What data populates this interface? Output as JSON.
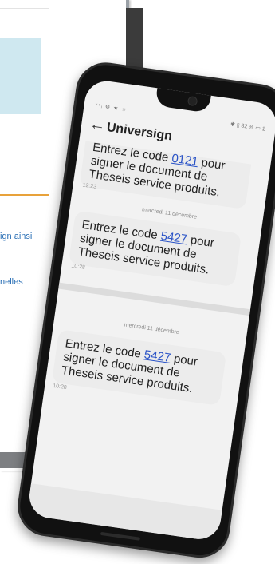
{
  "background_doc": {
    "link1": "ign ainsi",
    "link2": "nelles"
  },
  "phone": {
    "status_left": "ᵛ⁴ᵢ ⚙ ★ ☼",
    "status_right": "✱ ▯ 82 % ▭ 1",
    "contact": "Universign",
    "messages": [
      {
        "prefix": "Entrez le code ",
        "code": "0121",
        "suffix": " pour signer le document de Theseis service produits.",
        "time": "12:23"
      },
      {
        "date": "mercredi 11 décembre",
        "prefix": "Entrez le code ",
        "code": "5427",
        "suffix": " pour signer le document de Theseis service produits.",
        "time": "10:28"
      },
      {
        "date": "mercredi 11 décembre",
        "prefix": "Entrez le code ",
        "code": "5427",
        "suffix": " pour signer le document de Theseis service produits.",
        "time": "10:28"
      }
    ]
  }
}
